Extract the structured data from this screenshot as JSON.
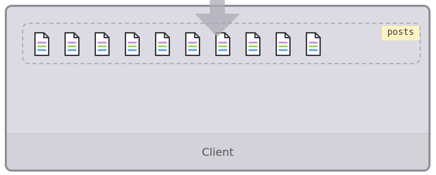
{
  "client": {
    "label": "Client"
  },
  "posts": {
    "tag": "posts",
    "item_count": 10,
    "item_icon": "document-icon"
  },
  "colors": {
    "box_fill": "#dcdae2",
    "box_border": "#8f8e95",
    "tag_fill": "#fbf3c2",
    "arrow_fill": "#aba9b5",
    "doc_line_1": "#c98be0",
    "doc_line_2": "#9ed44a",
    "doc_line_3": "#5aa3e6"
  }
}
